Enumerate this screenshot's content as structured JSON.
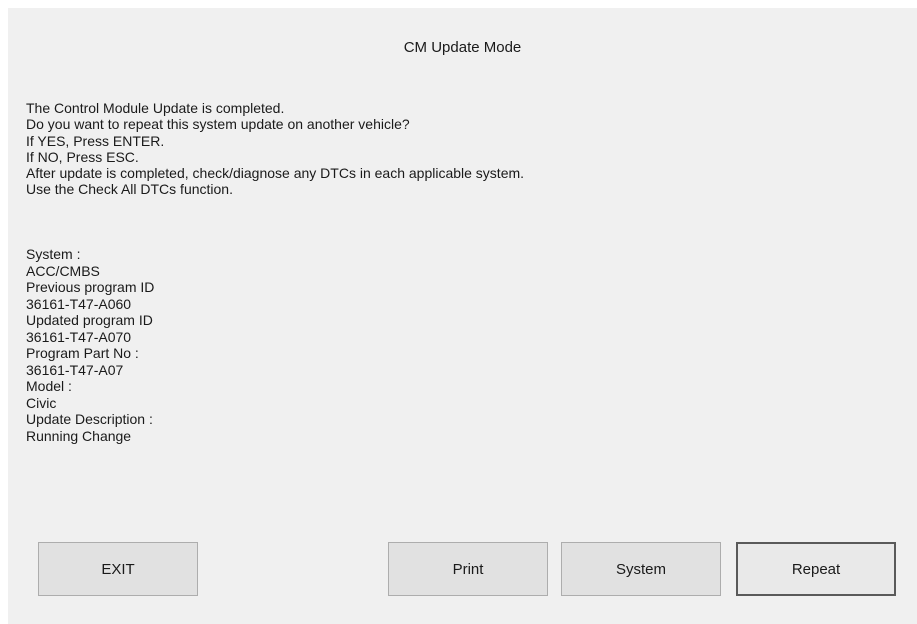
{
  "window": {
    "title": "CM Update Mode"
  },
  "message": {
    "lines": [
      "The Control Module Update is completed.",
      "Do you want to repeat this system update on another vehicle?",
      "If YES, Press ENTER.",
      "If NO, Press ESC.",
      "After update is completed, check/diagnose any DTCs in each applicable system.",
      "Use the Check All DTCs function."
    ]
  },
  "details": {
    "system_label": "System :",
    "system_value": "ACC/CMBS",
    "previous_id_label": "Previous program ID",
    "previous_id_value": "36161-T47-A060",
    "updated_id_label": "Updated program ID",
    "updated_id_value": "36161-T47-A070",
    "part_no_label": "Program Part No :",
    "part_no_value": "36161-T47-A07",
    "model_label": "Model :",
    "model_value": "Civic",
    "description_label": "Update Description :",
    "description_value": "Running Change"
  },
  "buttons": {
    "exit": "EXIT",
    "print": "Print",
    "system": "System",
    "repeat": "Repeat"
  }
}
